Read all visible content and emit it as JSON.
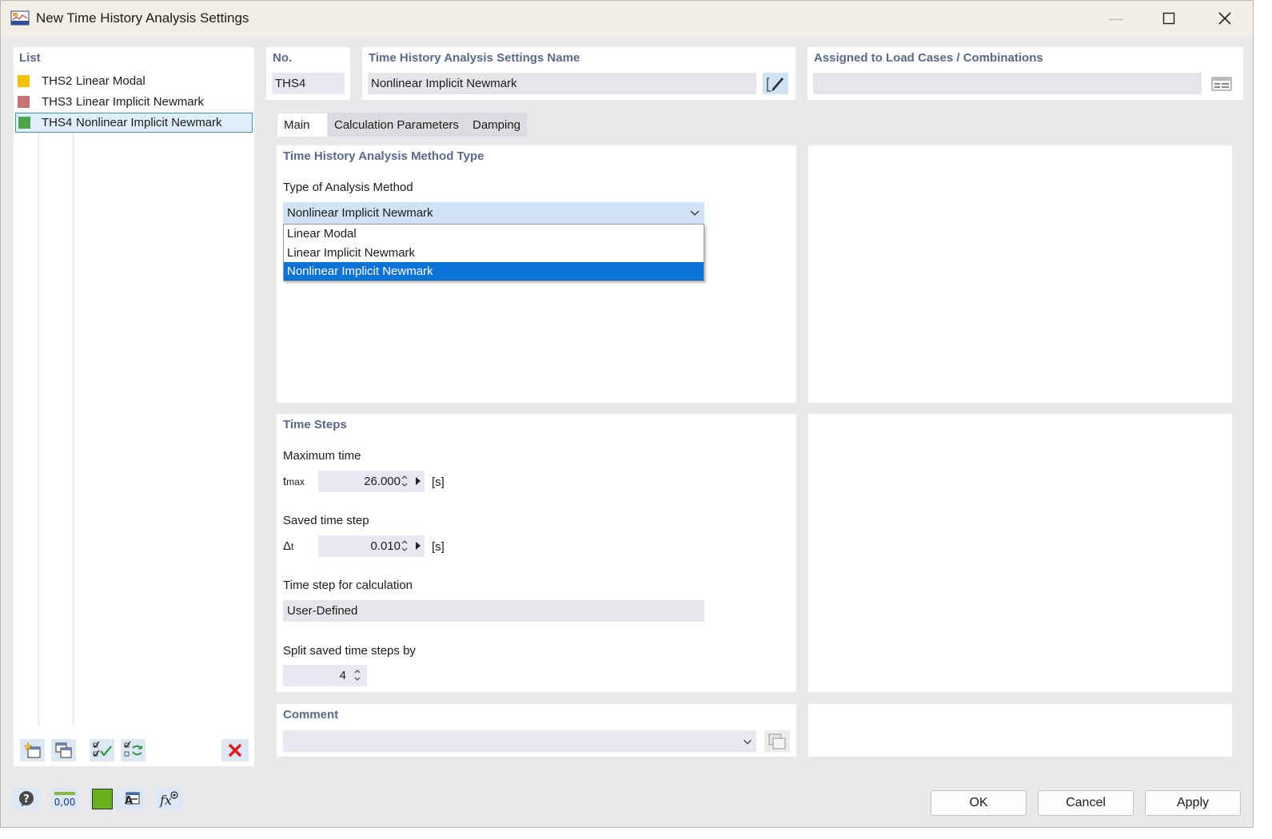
{
  "window": {
    "title": "New Time History Analysis Settings",
    "min_glyph": "—",
    "max_glyph": "☐",
    "close_glyph": "✕"
  },
  "list": {
    "title": "List",
    "items": [
      {
        "no": "THS2",
        "name": "Linear Modal",
        "color": "#f5c000"
      },
      {
        "no": "THS3",
        "name": "Linear Implicit Newmark",
        "color": "#c87274"
      },
      {
        "no": "THS4",
        "name": "Nonlinear Implicit Newmark",
        "color": "#4aa54a"
      }
    ],
    "selected_index": 2,
    "tools": [
      "new-item-icon",
      "copy-item-icon",
      "check-all-icon",
      "check-toggle-icon",
      "delete-icon"
    ]
  },
  "header": {
    "no_label": "No.",
    "no_value": "THS4",
    "name_label": "Time History Analysis Settings Name",
    "name_value": "Nonlinear Implicit Newmark",
    "assigned_label": "Assigned to Load Cases / Combinations",
    "assigned_value": ""
  },
  "tabs": [
    {
      "label": "Main",
      "active": true
    },
    {
      "label": "Calculation Parameters",
      "active": false
    },
    {
      "label": "Damping",
      "active": false
    }
  ],
  "method": {
    "section_title": "Time History Analysis Method Type",
    "type_label": "Type of Analysis Method",
    "selected": "Nonlinear Implicit Newmark",
    "options": [
      "Linear Modal",
      "Linear Implicit Newmark",
      "Nonlinear Implicit Newmark"
    ]
  },
  "time_steps": {
    "section_title": "Time Steps",
    "max_time_label": "Maximum time",
    "max_time_symbol": "t",
    "max_time_subscript": "max",
    "max_time_value": "26.000",
    "max_time_unit": "[s]",
    "saved_step_label": "Saved time step",
    "saved_step_symbol": "Δ",
    "saved_step_subscript": "t",
    "saved_step_value": "0.010",
    "saved_step_unit": "[s]",
    "calc_step_label": "Time step for calculation",
    "calc_step_value": "User-Defined",
    "split_label": "Split saved time steps by",
    "split_value": "4"
  },
  "comment": {
    "section_title": "Comment",
    "value": ""
  },
  "footer": {
    "ok_label": "OK",
    "cancel_label": "Cancel",
    "apply_label": "Apply",
    "number_icon_text": "0,00",
    "color_swatch": "#6ab01a"
  }
}
